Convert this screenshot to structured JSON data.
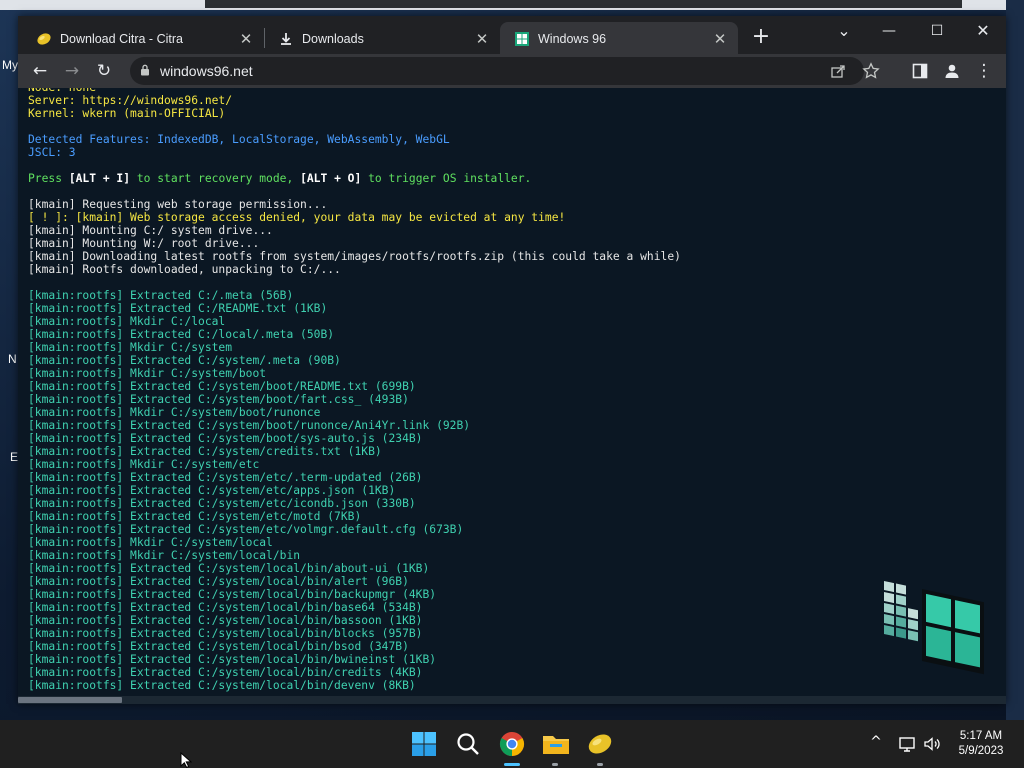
{
  "desktop": {
    "labels": [
      "My",
      "N",
      "E"
    ]
  },
  "browser": {
    "tabs": [
      {
        "title": "Download Citra - Citra",
        "icon": "citra-icon",
        "close": "✕"
      },
      {
        "title": "Downloads",
        "icon": "download-icon",
        "close": "✕"
      },
      {
        "title": "Windows 96",
        "icon": "windows96-icon",
        "close": "✕"
      }
    ],
    "new_tab": "+",
    "tab_search": "⌄",
    "window_controls": {
      "minimize": "—",
      "maximize": "☐",
      "close": "✕"
    },
    "toolbar": {
      "back": "←",
      "forward": "→",
      "reload": "↻",
      "menu": "⋮"
    },
    "address": "windows96.net"
  },
  "terminal": {
    "lines": [
      {
        "text": "Node: none",
        "color": "yellow"
      },
      {
        "text": "Server: https://windows96.net/",
        "color": "yellow"
      },
      {
        "text": "Kernel: wkern (main-OFFICIAL)",
        "color": "yellow"
      },
      {
        "text": "",
        "color": "gap"
      },
      {
        "text": "Detected Features: IndexedDB, LocalStorage, WebAssembly, WebGL",
        "color": "blue"
      },
      {
        "text": "JSCL: 3",
        "color": "blue"
      },
      {
        "text": "",
        "color": "gap"
      },
      {
        "text": "Press [ALT + I] to start recovery mode, [ALT + O] to trigger OS installer.",
        "color": "green"
      },
      {
        "text": "",
        "color": "gap"
      },
      {
        "text": "[kmain] Requesting web storage permission...",
        "color": "white"
      },
      {
        "text": "[ ! ]: [kmain] Web storage access denied, your data may be evicted at any time!",
        "color": "warn"
      },
      {
        "text": "[kmain] Mounting C:/ system drive...",
        "color": "white"
      },
      {
        "text": "[kmain] Mounting W:/ root drive...",
        "color": "white"
      },
      {
        "text": "[kmain] Downloading latest rootfs from system/images/rootfs/rootfs.zip (this could take a while)",
        "color": "white"
      },
      {
        "text": "[kmain] Rootfs downloaded, unpacking to C:/...",
        "color": "white"
      },
      {
        "text": "",
        "color": "gap"
      },
      {
        "text": "[kmain:rootfs] Extracted C:/.meta (56B)",
        "color": "teal"
      },
      {
        "text": "[kmain:rootfs] Extracted C:/README.txt (1KB)",
        "color": "teal"
      },
      {
        "text": "[kmain:rootfs] Mkdir C:/local",
        "color": "teal"
      },
      {
        "text": "[kmain:rootfs] Extracted C:/local/.meta (50B)",
        "color": "teal"
      },
      {
        "text": "[kmain:rootfs] Mkdir C:/system",
        "color": "teal"
      },
      {
        "text": "[kmain:rootfs] Extracted C:/system/.meta (90B)",
        "color": "teal"
      },
      {
        "text": "[kmain:rootfs] Mkdir C:/system/boot",
        "color": "teal"
      },
      {
        "text": "[kmain:rootfs] Extracted C:/system/boot/README.txt (699B)",
        "color": "teal"
      },
      {
        "text": "[kmain:rootfs] Extracted C:/system/boot/fart.css_ (493B)",
        "color": "teal"
      },
      {
        "text": "[kmain:rootfs] Mkdir C:/system/boot/runonce",
        "color": "teal"
      },
      {
        "text": "[kmain:rootfs] Extracted C:/system/boot/runonce/Ani4Yr.link (92B)",
        "color": "teal"
      },
      {
        "text": "[kmain:rootfs] Extracted C:/system/boot/sys-auto.js (234B)",
        "color": "teal"
      },
      {
        "text": "[kmain:rootfs] Extracted C:/system/credits.txt (1KB)",
        "color": "teal"
      },
      {
        "text": "[kmain:rootfs] Mkdir C:/system/etc",
        "color": "teal"
      },
      {
        "text": "[kmain:rootfs] Extracted C:/system/etc/.term-updated (26B)",
        "color": "teal"
      },
      {
        "text": "[kmain:rootfs] Extracted C:/system/etc/apps.json (1KB)",
        "color": "teal"
      },
      {
        "text": "[kmain:rootfs] Extracted C:/system/etc/icondb.json (330B)",
        "color": "teal"
      },
      {
        "text": "[kmain:rootfs] Extracted C:/system/etc/motd (7KB)",
        "color": "teal"
      },
      {
        "text": "[kmain:rootfs] Extracted C:/system/etc/volmgr.default.cfg (673B)",
        "color": "teal"
      },
      {
        "text": "[kmain:rootfs] Mkdir C:/system/local",
        "color": "teal"
      },
      {
        "text": "[kmain:rootfs] Mkdir C:/system/local/bin",
        "color": "teal"
      },
      {
        "text": "[kmain:rootfs] Extracted C:/system/local/bin/about-ui (1KB)",
        "color": "teal"
      },
      {
        "text": "[kmain:rootfs] Extracted C:/system/local/bin/alert (96B)",
        "color": "teal"
      },
      {
        "text": "[kmain:rootfs] Extracted C:/system/local/bin/backupmgr (4KB)",
        "color": "teal"
      },
      {
        "text": "[kmain:rootfs] Extracted C:/system/local/bin/base64 (534B)",
        "color": "teal"
      },
      {
        "text": "[kmain:rootfs] Extracted C:/system/local/bin/bassoon (1KB)",
        "color": "teal"
      },
      {
        "text": "[kmain:rootfs] Extracted C:/system/local/bin/blocks (957B)",
        "color": "teal"
      },
      {
        "text": "[kmain:rootfs] Extracted C:/system/local/bin/bsod (347B)",
        "color": "teal"
      },
      {
        "text": "[kmain:rootfs] Extracted C:/system/local/bin/bwineinst (1KB)",
        "color": "teal"
      },
      {
        "text": "[kmain:rootfs] Extracted C:/system/local/bin/credits (4KB)",
        "color": "teal"
      },
      {
        "text": "[kmain:rootfs] Extracted C:/system/local/bin/devenv (8KB)",
        "color": "teal"
      }
    ]
  },
  "taskbar": {
    "apps": [
      "start-icon",
      "search-icon",
      "chrome-icon",
      "file-explorer-icon",
      "citra-icon"
    ],
    "tray": {
      "chevron": "^",
      "network": "▭",
      "volume": "🔈"
    },
    "time": "5:17 AM",
    "date": "5/9/2023"
  },
  "colors": {
    "yellow": "#f5e642",
    "blue": "#4a9dff",
    "green": "#5fe05f",
    "white": "#e6e6e6",
    "teal": "#3fd1b0"
  }
}
